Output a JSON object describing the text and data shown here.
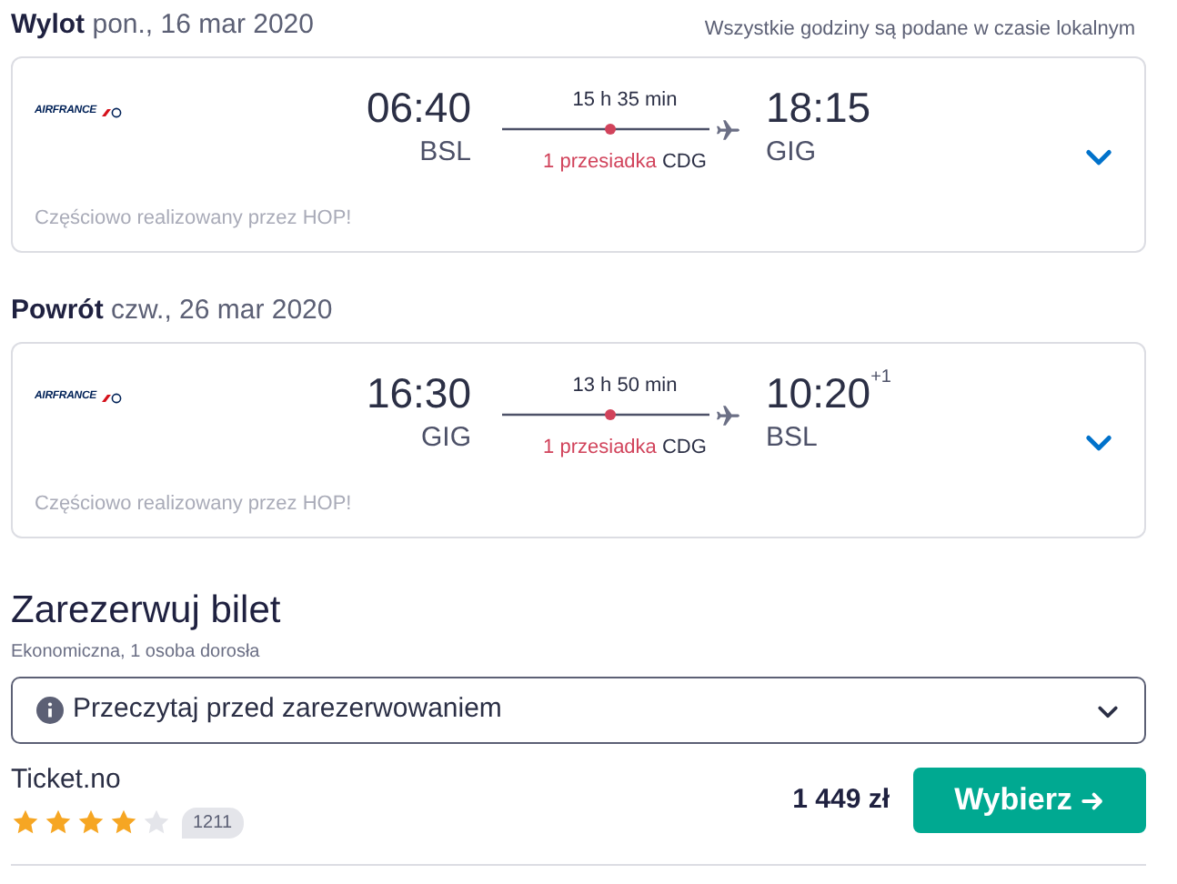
{
  "legs": [
    {
      "label": "Wylot",
      "date": "pon., 16 mar 2020",
      "note": "Wszystkie godziny są podane w czasie lokalnym",
      "airline": "AIRFRANCE",
      "depart_time": "06:40",
      "depart_airport": "BSL",
      "duration": "15 h 35 min",
      "stops": "1 przesiadka",
      "via": "CDG",
      "arrive_time": "18:15",
      "arrive_airport": "GIG",
      "operated": "Częściowo realizowany przez HOP!",
      "expanded": false
    },
    {
      "label": "Powrót",
      "date": "czw., 26 mar 2020",
      "airline": "AIRFRANCE",
      "depart_time": "16:30",
      "depart_airport": "GIG",
      "duration": "13 h 50 min",
      "stops": "1 przesiadka",
      "via": "CDG",
      "arrive_time": "10:20",
      "arrive_offset": "+1",
      "arrive_airport": "BSL",
      "operated": "Częściowo realizowany przez HOP!",
      "expanded": false
    }
  ],
  "booking": {
    "title": "Zarezerwuj bilet",
    "subtitle": "Ekonomiczna, 1 osoba dorosła",
    "notice": "Przeczytaj przed zarezerwowaniem",
    "notice_expanded": false,
    "provider": {
      "name": "Ticket.no",
      "stars": 4,
      "reviews": "1211",
      "price": "1 449 zł",
      "button": "Wybierz"
    }
  }
}
